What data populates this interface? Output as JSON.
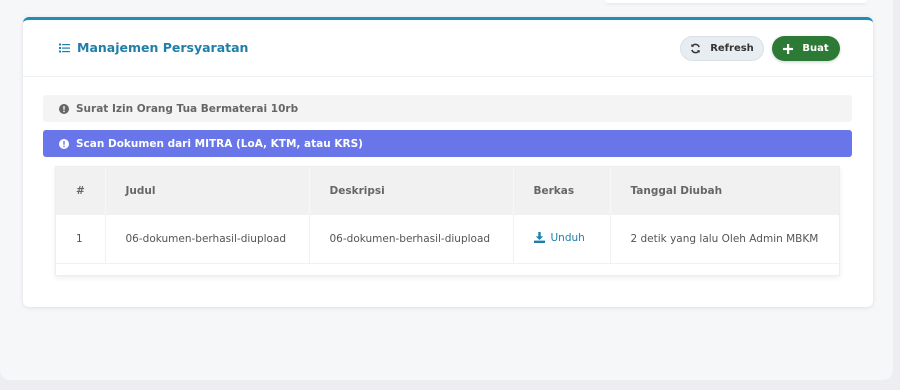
{
  "header": {
    "title": "Manajemen Persyaratan",
    "refresh_label": "Refresh",
    "create_label": "Buat"
  },
  "requirements": [
    {
      "label": "Surat Izin Orang Tua Bermaterai 10rb",
      "active": false
    },
    {
      "label": "Scan Dokumen dari MITRA (LoA, KTM, atau KRS)",
      "active": true
    }
  ],
  "table": {
    "columns": [
      "#",
      "Judul",
      "Deskripsi",
      "Berkas",
      "Tanggal Diubah"
    ],
    "rows": [
      {
        "no": "1",
        "judul": "06-dokumen-berhasil-diupload",
        "deskripsi": "06-dokumen-berhasil-diupload",
        "berkas": "Unduh",
        "tanggal": "2 detik yang lalu Oleh Admin MBKM"
      }
    ]
  },
  "colors": {
    "accent": "#1f7fa8",
    "create_button": "#2c7a35",
    "active_item": "#6876ea"
  },
  "icons": [
    "list-icon",
    "refresh-icon",
    "plus-icon",
    "info-circle-icon",
    "download-icon"
  ]
}
